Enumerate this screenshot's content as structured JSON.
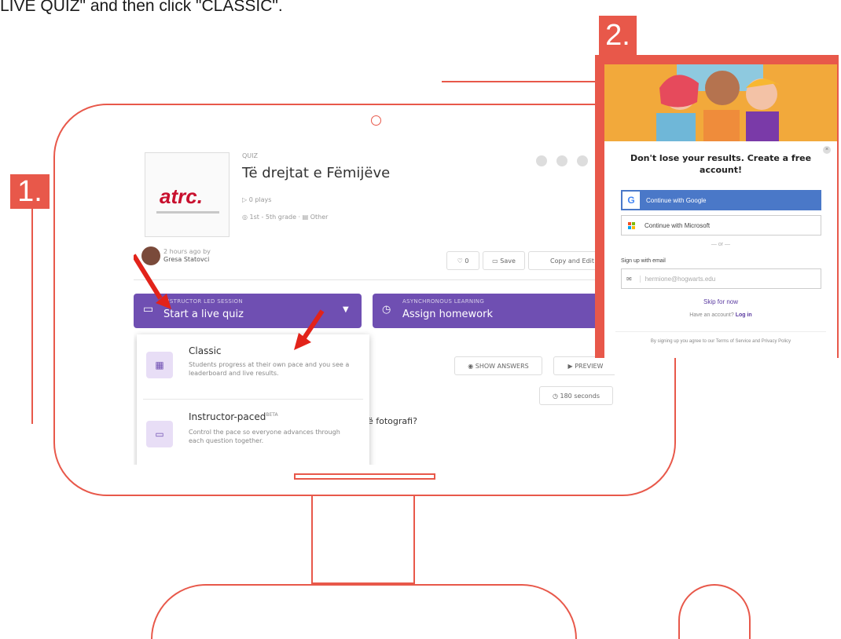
{
  "instruction_text": "LIVE QUIZ\" and then click \"CLASSIC\".",
  "steps": {
    "step1": "1.",
    "step2": "2."
  },
  "quiz": {
    "type_label": "QUIZ",
    "title": "Të drejtat e Fëmijëve",
    "logo_text": "atrc.",
    "plays": "0 plays",
    "grade": "1st - 5th grade",
    "subject": "Other",
    "author_time": "2 hours ago by",
    "author_name": "Gresa Statovci",
    "like_count": "0",
    "save_label": "Save",
    "copy_edit_label": "Copy and Edit"
  },
  "live_button": {
    "small_label": "INSTRUCTOR LED SESSION",
    "label": "Start a live quiz"
  },
  "homework_button": {
    "small_label": "ASYNCHRONOUS LEARNING",
    "label": "Assign homework"
  },
  "dropdown": {
    "classic_title": "Classic",
    "classic_desc": "Students progress at their own pace and you see a leaderboard and live results.",
    "instructor_title": "Instructor-paced",
    "instructor_badge": "BETA",
    "instructor_desc": "Control the pace so everyone advances through each question together."
  },
  "toolbar": {
    "show_answers": "SHOW ANSWERS",
    "preview": "PREVIEW",
    "timer": "180 seconds",
    "question_fragment": "ë fotografi?"
  },
  "modal": {
    "title": "Don't lose your results. Create a free account!",
    "google": "Continue with Google",
    "microsoft": "Continue with Microsoft",
    "or": "or",
    "email_label": "Sign up with email",
    "email_placeholder": "hermione@hogwarts.edu",
    "skip": "Skip for now",
    "have_account": "Have an account?",
    "login": "Log in",
    "terms": "By signing up you agree to our Terms of Service and Privacy Policy"
  },
  "colors": {
    "coral": "#e8584a",
    "purple": "#6f4fb2",
    "google_blue": "#4a78c8",
    "hero_orange": "#f2a93b"
  }
}
